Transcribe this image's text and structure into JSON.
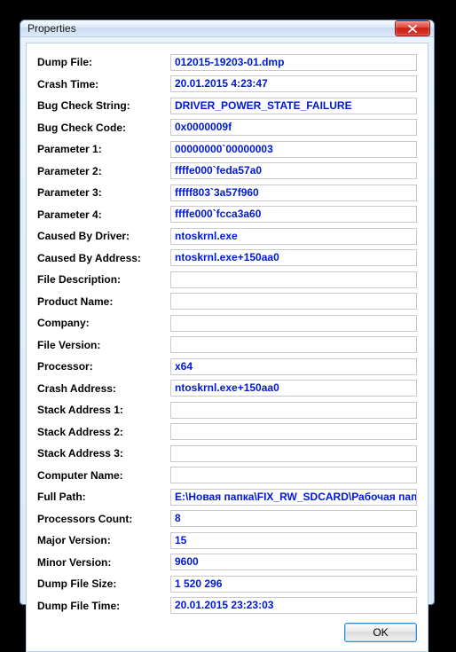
{
  "window": {
    "title": "Properties",
    "ok_label": "OK"
  },
  "fields": [
    {
      "label": "Dump File:",
      "value": "012015-19203-01.dmp"
    },
    {
      "label": "Crash Time:",
      "value": "20.01.2015 4:23:47"
    },
    {
      "label": "Bug Check String:",
      "value": "DRIVER_POWER_STATE_FAILURE"
    },
    {
      "label": "Bug Check Code:",
      "value": "0x0000009f"
    },
    {
      "label": "Parameter 1:",
      "value": "00000000`00000003"
    },
    {
      "label": "Parameter 2:",
      "value": "ffffe000`feda57a0"
    },
    {
      "label": "Parameter 3:",
      "value": "fffff803`3a57f960"
    },
    {
      "label": "Parameter 4:",
      "value": "ffffe000`fcca3a60"
    },
    {
      "label": "Caused By Driver:",
      "value": "ntoskrnl.exe"
    },
    {
      "label": "Caused By Address:",
      "value": "ntoskrnl.exe+150aa0"
    },
    {
      "label": "File Description:",
      "value": ""
    },
    {
      "label": "Product Name:",
      "value": ""
    },
    {
      "label": "Company:",
      "value": ""
    },
    {
      "label": "File Version:",
      "value": ""
    },
    {
      "label": "Processor:",
      "value": "x64"
    },
    {
      "label": "Crash Address:",
      "value": "ntoskrnl.exe+150aa0"
    },
    {
      "label": "Stack Address 1:",
      "value": ""
    },
    {
      "label": "Stack Address 2:",
      "value": ""
    },
    {
      "label": "Stack Address 3:",
      "value": ""
    },
    {
      "label": "Computer Name:",
      "value": ""
    },
    {
      "label": "Full Path:",
      "value": "E:\\Новая папка\\FIX_RW_SDCARD\\Рабочая папк"
    },
    {
      "label": "Processors Count:",
      "value": "8"
    },
    {
      "label": "Major Version:",
      "value": "15"
    },
    {
      "label": "Minor Version:",
      "value": "9600"
    },
    {
      "label": "Dump File Size:",
      "value": "1  520  296"
    },
    {
      "label": "Dump File Time:",
      "value": "20.01.2015 23:23:03"
    }
  ]
}
